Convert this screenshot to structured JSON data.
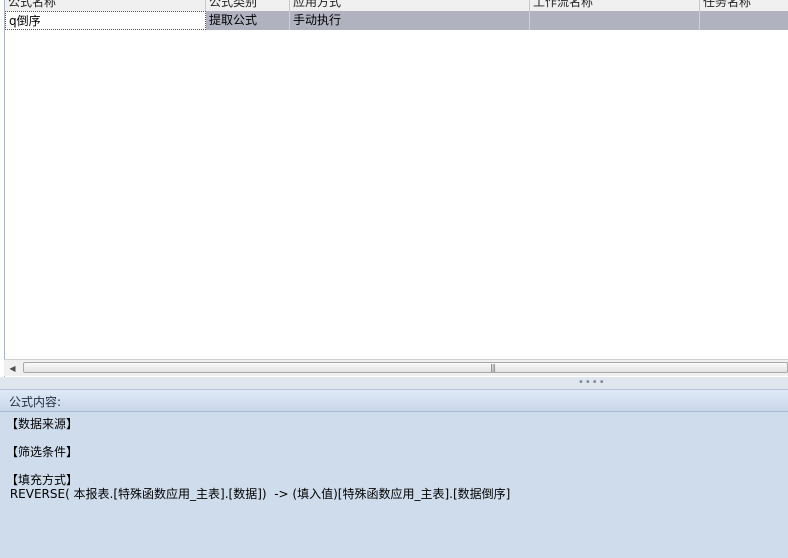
{
  "grid": {
    "columns": [
      "公式名称",
      "公式类别",
      "应用方式",
      "工作流名称",
      "任务名称"
    ],
    "rows": [
      {
        "name": "q倒序",
        "category": "提取公式",
        "mode": "手动执行",
        "workflow": "",
        "task": ""
      }
    ]
  },
  "scrollbar": {
    "left_arrow": "◀",
    "grip": "|||"
  },
  "splitter": {
    "grip": "••••"
  },
  "formula_panel": {
    "title": "公式内容:",
    "lines": [
      "【数据来源】",
      "【筛选条件】",
      "【填充方式】",
      " REVERSE( 本报表.[特殊函数应用_主表].[数据])  -> (填入值)[特殊函数应用_主表].[数据倒序]"
    ]
  },
  "colors": {
    "selected_row": "#b0b2c0",
    "panel_bg": "#cfdcec",
    "panel_header": "#d4e1f2"
  }
}
